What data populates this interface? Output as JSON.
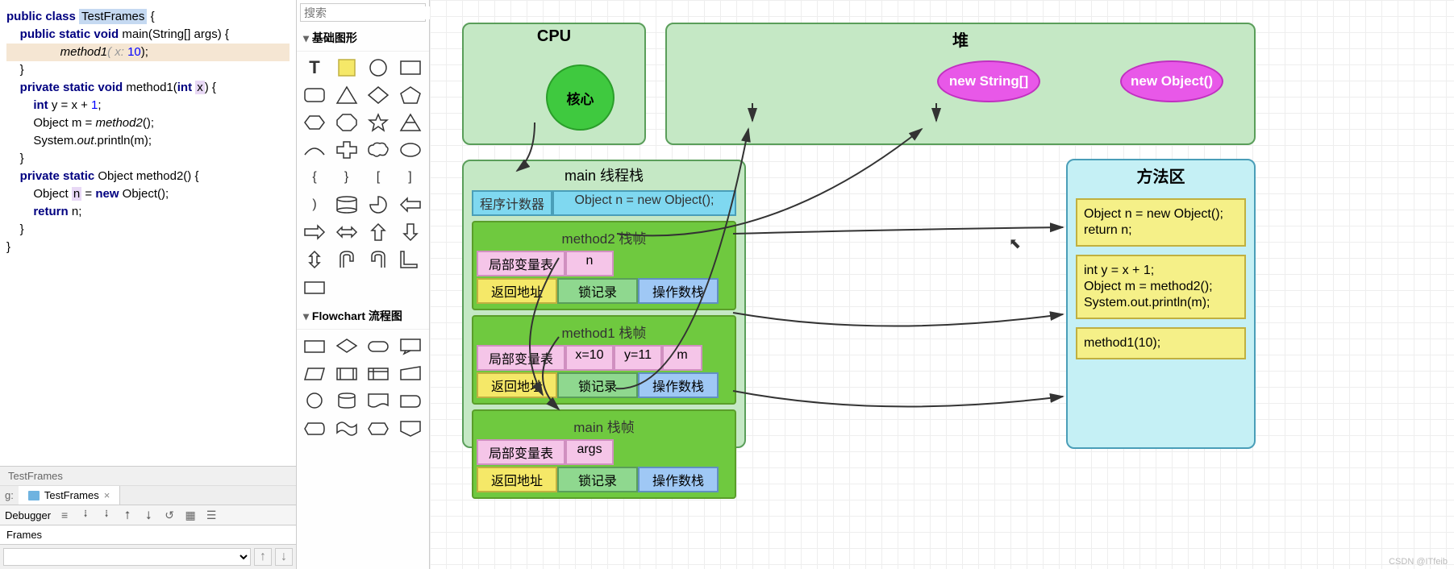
{
  "code": {
    "class_name": "TestFrames",
    "line1_pre": "public class ",
    "line1_post": " {",
    "line2": "    public static void main(String[] args) {",
    "line3_pre": "        method1",
    "line3_hint": "( x: ",
    "line3_num": "10",
    "line3_post": ");",
    "line4": "    }",
    "line5": "",
    "line6_pre": "    private static void method1(int ",
    "line6_var": "x",
    "line6_post": ") {",
    "line7": "        int y = x + 1;",
    "line8_pre": "        Object m = ",
    "line8_fn": "method2",
    "line8_post": "();",
    "line9_pre": "        System.",
    "line9_out": "out",
    "line9_post": ".println(m);",
    "line10": "    }",
    "line11": "",
    "line12": "    private static Object method2() {",
    "line13_pre": "        Object ",
    "line13_var": "n",
    "line13_post": " = new Object();",
    "line14_pre": "        return ",
    "line14_var": "n",
    "line14_post": ";",
    "line15": "    }",
    "line16": "}"
  },
  "breadcrumb": "TestFrames",
  "tab": {
    "name": "TestFrames",
    "g_label": "g:"
  },
  "debugger": {
    "label": "Debugger"
  },
  "frames": {
    "label": "Frames"
  },
  "shapes": {
    "search_placeholder": "搜索",
    "section1": "基础图形",
    "section2": "Flowchart 流程图"
  },
  "diagram": {
    "cpu": "CPU",
    "core": "核心",
    "heap": "堆",
    "new_string": "new String[]",
    "new_object": "new Object()",
    "stack_title": "main 线程栈",
    "counter": "程序计数器",
    "counter_code": "Object n = new Object();",
    "frame2": {
      "title": "method2 栈帧",
      "locals": "局部变量表",
      "n": "n",
      "ret": "返回地址",
      "lock": "锁记录",
      "ops": "操作数栈"
    },
    "frame1": {
      "title": "method1 栈帧",
      "locals": "局部变量表",
      "x": "x=10",
      "y": "y=11",
      "m": "m",
      "ret": "返回地址",
      "lock": "锁记录",
      "ops": "操作数栈"
    },
    "frame_main": {
      "title": "main 栈帧",
      "locals": "局部变量表",
      "args": "args",
      "ret": "返回地址",
      "lock": "锁记录",
      "ops": "操作数栈"
    },
    "method_area": "方法区",
    "m2_code": "Object n = new Object();\nreturn n;",
    "m1_code": "int y = x + 1;\nObject m = method2();\nSystem.out.println(m);",
    "main_code": "method1(10);"
  },
  "watermark": "CSDN @ITfeib"
}
